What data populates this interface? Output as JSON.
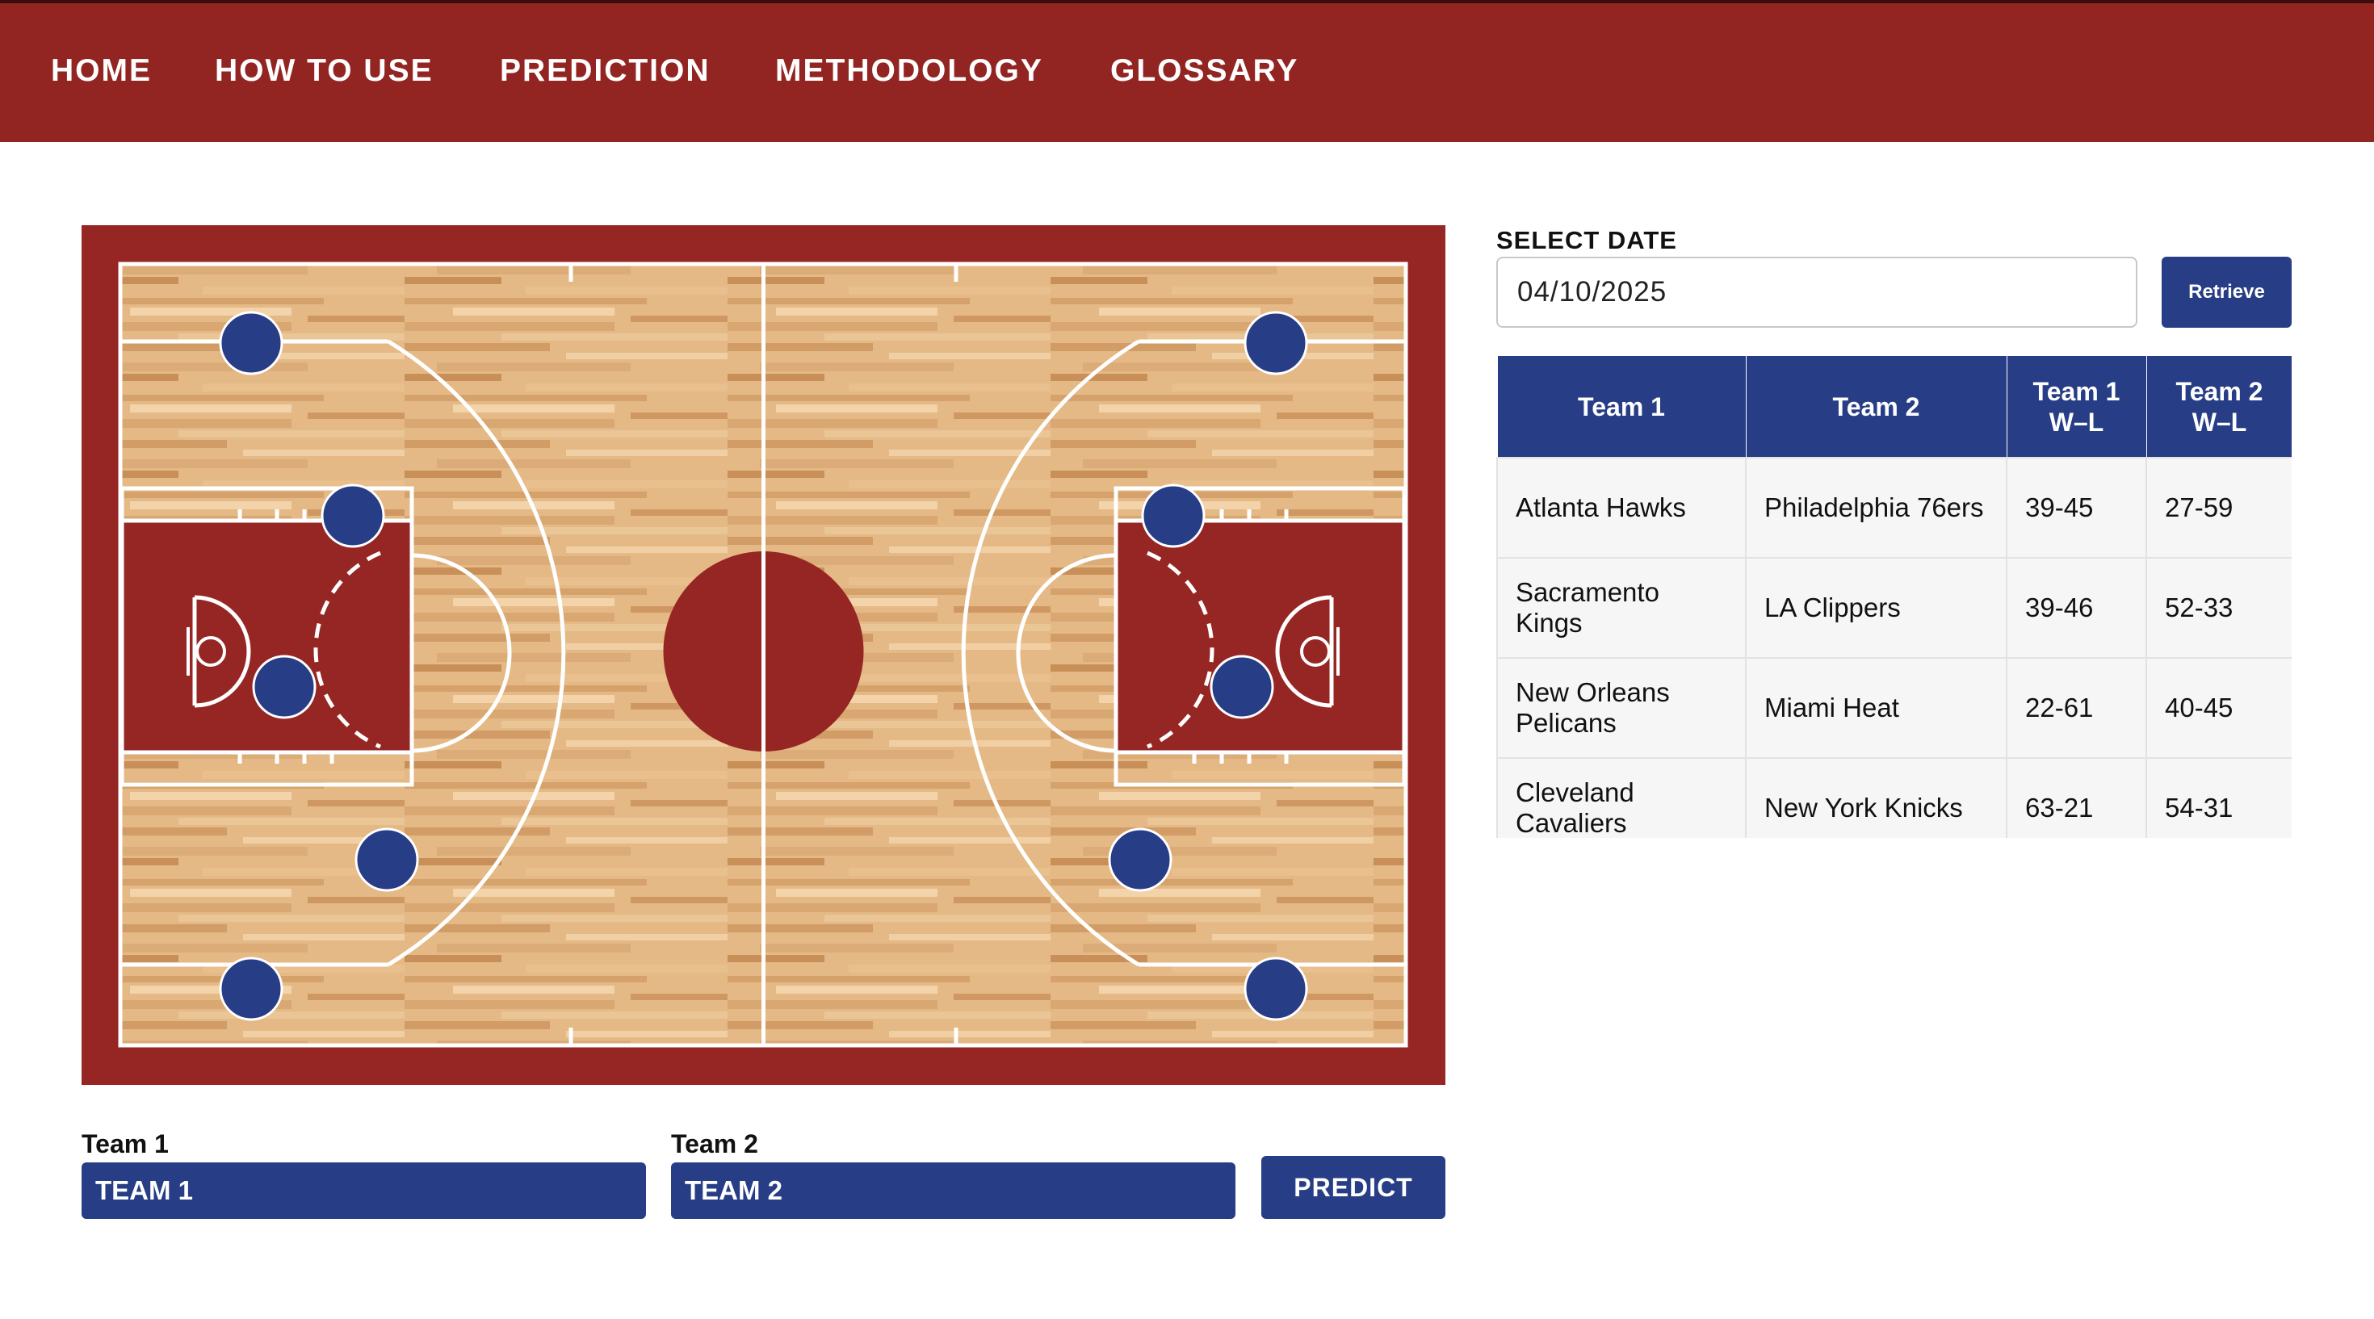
{
  "nav": {
    "items": [
      "HOME",
      "HOW TO USE",
      "PREDICTION",
      "METHODOLOGY",
      "GLOSSARY"
    ]
  },
  "court": {
    "border_color": "#962623",
    "paint_color": "#962623",
    "wood_color": "#e3b684",
    "player_color": "#273d85",
    "players_per_side": 5
  },
  "date_picker": {
    "label": "SELECT DATE",
    "value": "04/10/2025",
    "retrieve_label": "Retrieve"
  },
  "games_table": {
    "headers": [
      "Team 1",
      "Team 2",
      "Team 1 W–L",
      "Team 2 W–L"
    ],
    "rows": [
      [
        "Atlanta Hawks",
        "Philadelphia 76ers",
        "39-45",
        "27-59"
      ],
      [
        "Sacramento Kings",
        "LA Clippers",
        "39-46",
        "52-33"
      ],
      [
        "New Orleans Pelicans",
        "Miami Heat",
        "22-61",
        "40-45"
      ],
      [
        "Cleveland Cavaliers",
        "New York Knicks",
        "63-21",
        "54-31"
      ]
    ]
  },
  "selectors": {
    "team1_label": "Team 1",
    "team1_value": "TEAM 1",
    "team2_label": "Team 2",
    "team2_value": "TEAM 2",
    "predict_label": "PREDICT"
  },
  "colors": {
    "nav_bg": "#922521",
    "accent_blue": "#273d85"
  }
}
